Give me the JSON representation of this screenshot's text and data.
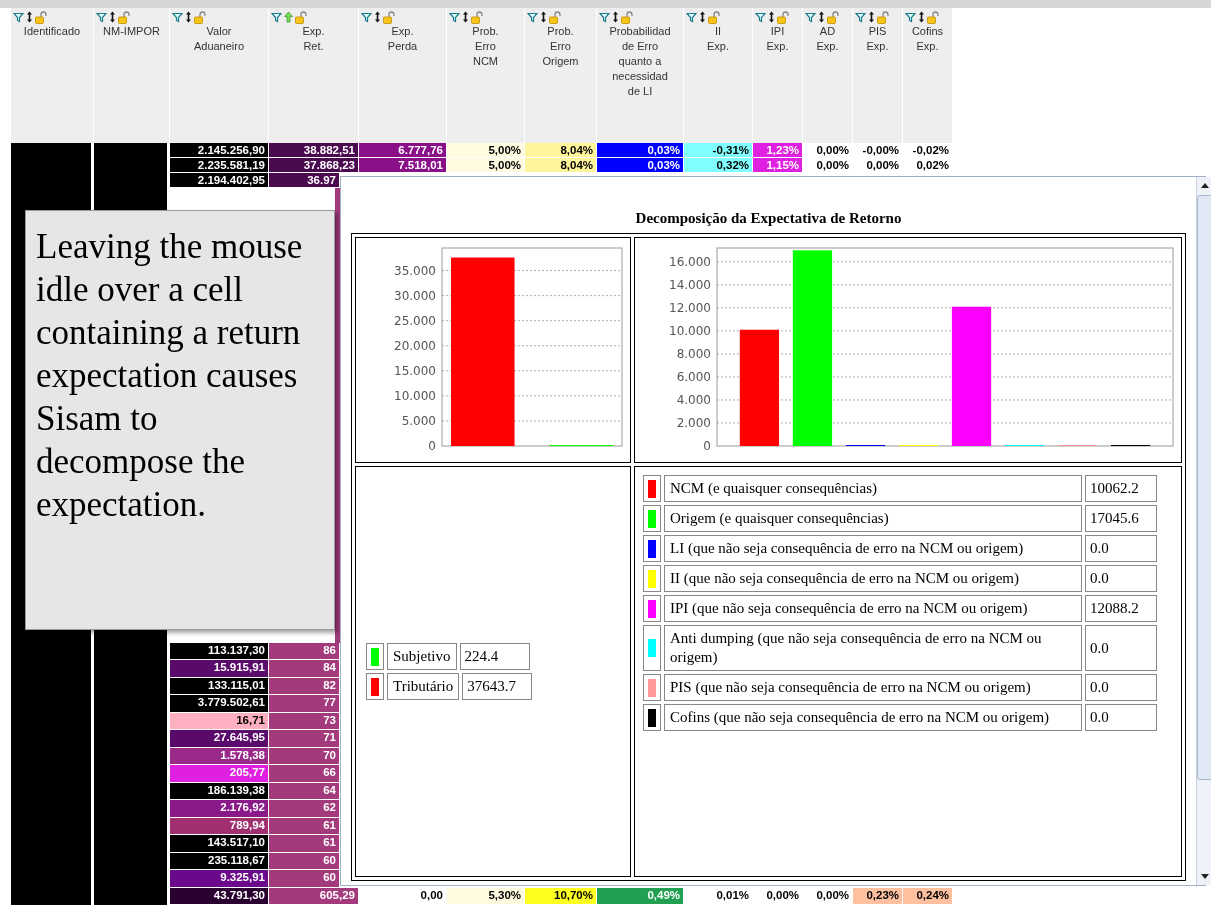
{
  "table": {
    "columns": [
      {
        "label": "Identificado",
        "sorted": false,
        "redacted": true
      },
      {
        "label": "NM-IMPOR",
        "sorted": false,
        "redacted": true
      },
      {
        "label": "Valor\nAduaneiro",
        "sorted": false,
        "redacted": false
      },
      {
        "label": "Exp.\nRet.",
        "sorted": true,
        "redacted": false
      },
      {
        "label": "Exp.\nPerda",
        "sorted": false,
        "redacted": false
      },
      {
        "label": "Prob.\nErro\nNCM",
        "sorted": false,
        "redacted": false
      },
      {
        "label": "Prob.\nErro\nOrigem",
        "sorted": false,
        "redacted": false
      },
      {
        "label": "Probabilidad\nde Erro\nquanto a\nnecessidad\nde LI",
        "sorted": false,
        "redacted": false
      },
      {
        "label": "II\nExp.",
        "sorted": false,
        "redacted": false
      },
      {
        "label": "IPI\nExp.",
        "sorted": false,
        "redacted": false
      },
      {
        "label": "AD\nExp.",
        "sorted": false,
        "redacted": false
      },
      {
        "label": "PIS\nExp.",
        "sorted": false,
        "redacted": false
      },
      {
        "label": "Cofins\nExp.",
        "sorted": false,
        "redacted": false
      }
    ],
    "top_rows": [
      {
        "kind": "full",
        "cells": [
          {
            "text": "2.145.256,90",
            "color": "#000000"
          },
          {
            "text": "38.882,51",
            "color": "#4a0a50"
          },
          {
            "text": "6.777,76",
            "color": "#8a108a"
          },
          {
            "text": "5,00%",
            "color": "#fffbe0"
          },
          {
            "text": "8,04%",
            "color": "#fff59a"
          },
          {
            "text": "0,03%",
            "color": "#0000ff"
          },
          {
            "text": "-0,31%",
            "color": "#80ffff"
          },
          {
            "text": "1,23%",
            "color": "#e020e0"
          },
          {
            "text": "0,00%",
            "color": "#ffffff"
          },
          {
            "text": "-0,00%",
            "color": "#ffffff"
          },
          {
            "text": "-0,02%",
            "color": "#ffffff"
          }
        ]
      },
      {
        "kind": "full",
        "cells": [
          {
            "text": "2.235.581,19",
            "color": "#000000"
          },
          {
            "text": "37.868,23",
            "color": "#4a0a50"
          },
          {
            "text": "7.518,01",
            "color": "#8a108a"
          },
          {
            "text": "5,00%",
            "color": "#fffbe0"
          },
          {
            "text": "8,04%",
            "color": "#fff59a"
          },
          {
            "text": "0,03%",
            "color": "#0000ff"
          },
          {
            "text": "0,32%",
            "color": "#80ffff"
          },
          {
            "text": "1,15%",
            "color": "#e020e0"
          },
          {
            "text": "0,00%",
            "color": "#ffffff"
          },
          {
            "text": "0,00%",
            "color": "#ffffff"
          },
          {
            "text": "0,02%",
            "color": "#ffffff"
          }
        ]
      },
      {
        "kind": "partial",
        "cells": [
          {
            "text": "2.194.402,95",
            "color": "#000000"
          },
          {
            "text": "36.97",
            "color": "#4a0a50"
          }
        ]
      }
    ],
    "bottom_rows": [
      {
        "kind": "partial",
        "cells": [
          {
            "text": "113.137,30",
            "color": "#000000"
          },
          {
            "text": "86",
            "color": "#a33a7c"
          }
        ]
      },
      {
        "kind": "partial",
        "cells": [
          {
            "text": "15.915,91",
            "color": "#5a0a6a"
          },
          {
            "text": "84",
            "color": "#a33a7c"
          }
        ]
      },
      {
        "kind": "partial",
        "cells": [
          {
            "text": "133.115,01",
            "color": "#000000"
          },
          {
            "text": "82",
            "color": "#a33a7c"
          }
        ]
      },
      {
        "kind": "partial",
        "cells": [
          {
            "text": "3.779.502,61",
            "color": "#000000"
          },
          {
            "text": "77",
            "color": "#a33a7c"
          }
        ]
      },
      {
        "kind": "partial",
        "cells": [
          {
            "text": "16,71",
            "color": "#ffb0c0"
          },
          {
            "text": "73",
            "color": "#a33a7c"
          }
        ]
      },
      {
        "kind": "partial",
        "cells": [
          {
            "text": "27.645,95",
            "color": "#5a0a6a"
          },
          {
            "text": "71",
            "color": "#a33a7c"
          }
        ]
      },
      {
        "kind": "partial",
        "cells": [
          {
            "text": "1.578,38",
            "color": "#9a2a8a"
          },
          {
            "text": "70",
            "color": "#a33a7c"
          }
        ]
      },
      {
        "kind": "partial",
        "cells": [
          {
            "text": "205,77",
            "color": "#e020e0"
          },
          {
            "text": "66",
            "color": "#a33a7c"
          }
        ]
      },
      {
        "kind": "partial",
        "cells": [
          {
            "text": "186.139,38",
            "color": "#000000"
          },
          {
            "text": "64",
            "color": "#a33a7c"
          }
        ]
      },
      {
        "kind": "partial",
        "cells": [
          {
            "text": "2.176,92",
            "color": "#8a1a8a"
          },
          {
            "text": "62",
            "color": "#a33a7c"
          }
        ]
      },
      {
        "kind": "partial",
        "cells": [
          {
            "text": "789,94",
            "color": "#a03070"
          },
          {
            "text": "61",
            "color": "#a33a7c"
          }
        ]
      },
      {
        "kind": "partial",
        "cells": [
          {
            "text": "143.517,10",
            "color": "#000000"
          },
          {
            "text": "61",
            "color": "#a33a7c"
          }
        ]
      },
      {
        "kind": "partial",
        "cells": [
          {
            "text": "235.118,67",
            "color": "#000000"
          },
          {
            "text": "60",
            "color": "#a33a7c"
          }
        ]
      },
      {
        "kind": "partial",
        "cells": [
          {
            "text": "9.325,91",
            "color": "#6a0a8a"
          },
          {
            "text": "60",
            "color": "#a33a7c"
          }
        ]
      },
      {
        "kind": "full",
        "cells": [
          {
            "text": "43.791,30",
            "color": "#2a0030"
          },
          {
            "text": "605,29",
            "color": "#a33a7c"
          },
          {
            "text": "0,00",
            "color": "#ffffff"
          },
          {
            "text": "5,30%",
            "color": "#fffbe0"
          },
          {
            "text": "10,70%",
            "color": "#ffff20"
          },
          {
            "text": "0,49%",
            "color": "#20a050"
          },
          {
            "text": "0,01%",
            "color": "#ffffff"
          },
          {
            "text": "0,00%",
            "color": "#ffffff"
          },
          {
            "text": "0,00%",
            "color": "#ffffff"
          },
          {
            "text": "0,23%",
            "color": "#ffc0a0"
          },
          {
            "text": "0,24%",
            "color": "#ffc0a0"
          }
        ]
      }
    ]
  },
  "callout": {
    "text": "Leaving the mouse idle over a cell containing a return expectation causes Sisam to decompose the expectation."
  },
  "popup": {
    "title": "Decomposição da Expectativa de Retorno",
    "charts": [
      {
        "chart_data": {
          "type": "bar",
          "grid": true,
          "ylim": [
            0,
            39500
          ],
          "yticks": [
            {
              "value": 0,
              "label": "0"
            },
            {
              "value": 5000,
              "label": "5.000"
            },
            {
              "value": 10000,
              "label": "10.000"
            },
            {
              "value": 15000,
              "label": "15.000"
            },
            {
              "value": 20000,
              "label": "20.000"
            },
            {
              "value": 25000,
              "label": "25.000"
            },
            {
              "value": 30000,
              "label": "30.000"
            },
            {
              "value": 35000,
              "label": "35.000"
            }
          ],
          "series": [
            {
              "color": "#ff0000",
              "values": [
                37600
              ]
            },
            {
              "color": "#00ff00",
              "values": [
                200
              ]
            }
          ]
        }
      },
      {
        "chart_data": {
          "type": "bar",
          "grid": true,
          "ylim": [
            0,
            17200
          ],
          "yticks": [
            {
              "value": 0,
              "label": "0"
            },
            {
              "value": 2000,
              "label": "2.000"
            },
            {
              "value": 4000,
              "label": "4.000"
            },
            {
              "value": 6000,
              "label": "6.000"
            },
            {
              "value": 8000,
              "label": "8.000"
            },
            {
              "value": 10000,
              "label": "10.000"
            },
            {
              "value": 12000,
              "label": "12.000"
            },
            {
              "value": 14000,
              "label": "14.000"
            },
            {
              "value": 16000,
              "label": "16.000"
            }
          ],
          "series": [
            {
              "color": "#ff0000",
              "values": [
                10100
              ]
            },
            {
              "color": "#00ff00",
              "values": [
                17000
              ]
            },
            {
              "color": "#0000ff",
              "values": [
                0
              ]
            },
            {
              "color": "#ffff00",
              "values": [
                0
              ]
            },
            {
              "color": "#ff00ff",
              "values": [
                12100
              ]
            },
            {
              "color": "#00ffff",
              "values": [
                0
              ]
            },
            {
              "color": "#ff9999",
              "values": [
                0
              ]
            },
            {
              "color": "#000000",
              "values": [
                0
              ]
            }
          ]
        }
      }
    ],
    "legends": [
      [
        {
          "color": "#00ff00",
          "label": "Subjetivo",
          "value": "224.4"
        },
        {
          "color": "#ff0000",
          "label": "Tributário",
          "value": "37643.7"
        }
      ],
      [
        {
          "color": "#ff0000",
          "label": "NCM (e quaisquer consequências)",
          "value": "10062.2"
        },
        {
          "color": "#00ff00",
          "label": "Origem (e quaisquer consequências)",
          "value": "17045.6"
        },
        {
          "color": "#0000ff",
          "label": "LI (que não seja consequência de erro na NCM ou origem)",
          "value": "0.0"
        },
        {
          "color": "#ffff00",
          "label": "II (que não seja consequência de erro na NCM ou origem)",
          "value": "0.0"
        },
        {
          "color": "#ff00ff",
          "label": "IPI (que não seja consequência de erro na NCM ou origem)",
          "value": "12088.2"
        },
        {
          "color": "#00ffff",
          "label": "Anti dumping (que não seja consequência de erro na NCM ou origem)",
          "value": "0.0"
        },
        {
          "color": "#ff9999",
          "label": "PIS (que não seja consequência de erro na NCM ou origem)",
          "value": "0.0"
        },
        {
          "color": "#000000",
          "label": "Cofins (que não seja consequência de erro na NCM ou origem)",
          "value": "0.0"
        }
      ]
    ]
  }
}
